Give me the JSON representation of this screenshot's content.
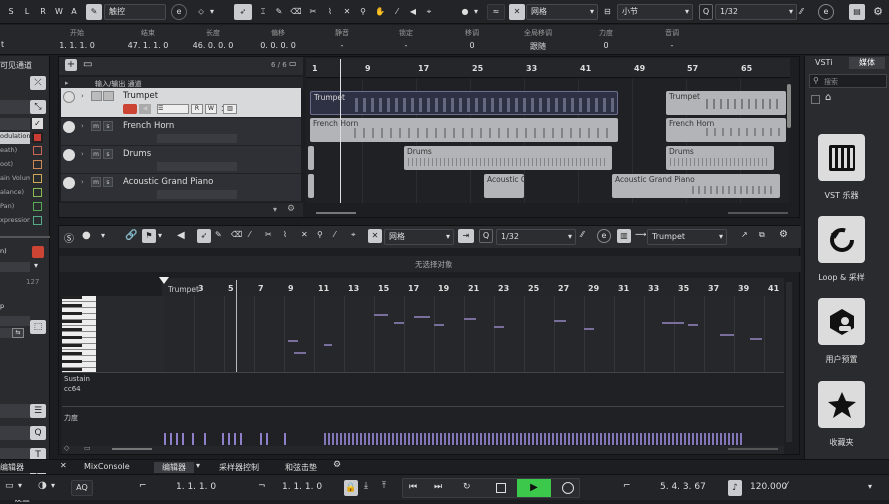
{
  "toolbar": {
    "modes": [
      "S",
      "L",
      "R",
      "W",
      "A"
    ],
    "touch_mode": "触控",
    "snap_type": "网格",
    "grid": "小节",
    "quantize": "1/32"
  },
  "infoline": {
    "fields": [
      {
        "label": "开始",
        "value": "1. 1. 1. 0"
      },
      {
        "label": "结束",
        "value": "47. 1. 1. 0"
      },
      {
        "label": "长度",
        "value": "46. 0. 0. 0"
      },
      {
        "label": "偏移",
        "value": "0. 0. 0. 0"
      },
      {
        "label": "静音",
        "value": "-"
      },
      {
        "label": "锁定",
        "value": "-"
      },
      {
        "label": "移调",
        "value": "0"
      },
      {
        "label": "全局移调",
        "value": "跟随"
      },
      {
        "label": "力度",
        "value": "0"
      },
      {
        "label": "音调",
        "value": "-"
      }
    ],
    "left_cut": "t"
  },
  "left_panel": {
    "title": "可见通道",
    "cc_lanes": [
      "odulation)",
      "eath)",
      "oot)",
      "ain Volum",
      "alance)",
      "Pan)",
      "xpression"
    ],
    "labels": [
      "n)",
      "p"
    ],
    "number": "127",
    "settings_label": "设置"
  },
  "tracklist": {
    "io_label": "输入/输出 通道",
    "count": "6 / 6",
    "tracks": [
      {
        "name": "Trumpet",
        "num": "1"
      },
      {
        "name": "French Horn"
      },
      {
        "name": "Drums"
      },
      {
        "name": "Acoustic Grand Piano"
      }
    ]
  },
  "ruler": {
    "bars": [
      "1",
      "9",
      "17",
      "25",
      "33",
      "41",
      "49",
      "57",
      "65"
    ]
  },
  "clips": {
    "trumpet": [
      "Trumpet",
      "Trumpet"
    ],
    "horn": [
      "French Horn",
      "French Horn"
    ],
    "drums": [
      "Drums",
      "Drums"
    ],
    "piano": [
      "Acoustic Gi",
      "Acoustic Grand Piano"
    ]
  },
  "editor": {
    "snap_type": "网格",
    "quantize": "1/32",
    "track": "Trumpet",
    "no_selection": "无选择对象",
    "part_name": "Trumpet",
    "bars": [
      "3",
      "5",
      "7",
      "9",
      "11",
      "13",
      "15",
      "17",
      "19",
      "21",
      "23",
      "25",
      "27",
      "29",
      "31",
      "33",
      "35",
      "37",
      "39",
      "41"
    ],
    "sustain": "Sustain",
    "cc64": "cc64",
    "velocity": "力度"
  },
  "right_panel": {
    "tabs": [
      "VSTi",
      "媒体"
    ],
    "search_placeholder": "搜索",
    "tiles": [
      "VST 乐器",
      "Loop & 采样",
      "用户预置",
      "收藏夹"
    ]
  },
  "bottom_tabs": [
    "编辑器",
    "MixConsole",
    "编辑器",
    "采样器控制",
    "和弦击垫"
  ],
  "transport": {
    "aq": "AQ",
    "left_locator": "1. 1. 1. 0",
    "right_locator": "1. 1. 1. 0",
    "position": "5. 4. 3. 67",
    "tempo": "120.000"
  }
}
